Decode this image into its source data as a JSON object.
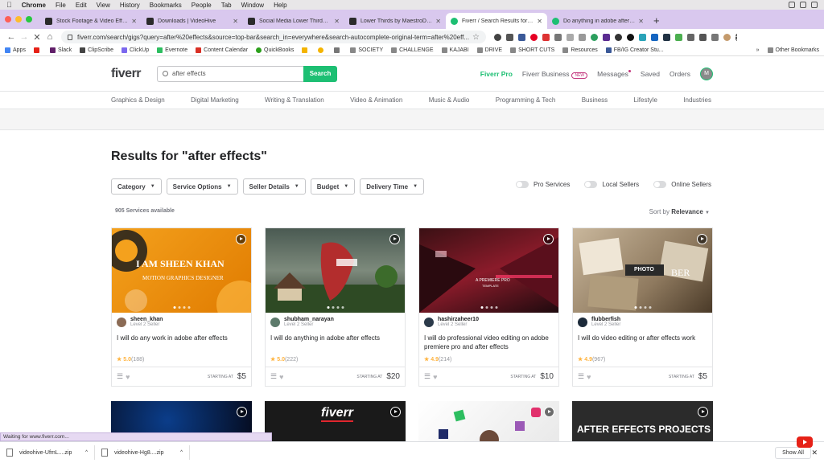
{
  "mac_menu": [
    "Chrome",
    "File",
    "Edit",
    "View",
    "History",
    "Bookmarks",
    "People",
    "Tab",
    "Window",
    "Help"
  ],
  "tabs": [
    {
      "label": "Stock Footage & Video Effects",
      "color": "#2b2b2b"
    },
    {
      "label": "Downloads | VideoHive",
      "color": "#2b2b2b"
    },
    {
      "label": "Social Media Lower Thirds V2 by",
      "color": "#2b2b2b"
    },
    {
      "label": "Lower Thirds by MaestroDesign",
      "color": "#2b2b2b"
    },
    {
      "label": "Fiverr / Search Results for 'after",
      "color": "#1dbf73"
    },
    {
      "label": "Do anything in adobe after effects",
      "color": "#1dbf73"
    }
  ],
  "address": {
    "url": "fiverr.com/search/gigs?query=after%20effects&source=top-bar&search_in=everywhere&search-autocomplete-original-term=after%20eff..."
  },
  "bookmarks": [
    "Apps",
    "",
    "Slack",
    "ClipScribe",
    "ClickUp",
    "Evernote",
    "Content Calendar",
    "QuickBooks",
    "",
    "",
    "",
    "SOCIETY",
    "CHALLENGE",
    "KAJABI",
    "DRIVE",
    "SHORT CUTS",
    "Resources",
    "FB/IG Creator Stu..."
  ],
  "other_bookmarks": "Other Bookmarks",
  "header": {
    "logo": "fiverr",
    "search_value": "after effects",
    "search_button": "Search",
    "fiverr_pro": "Fiverr Pro",
    "fiverr_business": "Fiverr Business",
    "new_badge": "NEW",
    "messages": "Messages",
    "saved": "Saved",
    "orders": "Orders",
    "avatar": "M"
  },
  "categories": [
    "Graphics & Design",
    "Digital Marketing",
    "Writing & Translation",
    "Video & Animation",
    "Music & Audio",
    "Programming & Tech",
    "Business",
    "Lifestyle",
    "Industries"
  ],
  "results_title": "Results for \"after effects\"",
  "filters": [
    "Category",
    "Service Options",
    "Seller Details",
    "Budget",
    "Delivery Time"
  ],
  "toggles": [
    "Pro Services",
    "Local Sellers",
    "Online Sellers"
  ],
  "services_count": "905 Services available",
  "sort": {
    "label": "Sort by",
    "value": "Relevance"
  },
  "gigs": [
    {
      "seller": "sheen_khan",
      "level": "Level 2 Seller",
      "title": "I will do any work in adobe after effects",
      "rating": "5.0",
      "reviews": "(188)",
      "starting": "STARTING AT",
      "price": "$5",
      "thumb_text": "I AM SHEEN KHAN",
      "thumb_sub": "MOTION GRAPHICS DESIGNER"
    },
    {
      "seller": "shubham_narayan",
      "level": "Level 2 Seller",
      "title": "I will do anything in adobe after effects",
      "rating": "5.0",
      "reviews": "(222)",
      "starting": "STARTING AT",
      "price": "$20",
      "thumb_text": "",
      "thumb_sub": ""
    },
    {
      "seller": "hashirzaheer10",
      "level": "Level 2 Seller",
      "title": "I will do professional video editing on adobe premiere pro and after effects",
      "rating": "4.9",
      "reviews": "(214)",
      "starting": "STARTING AT",
      "price": "$10",
      "thumb_text": "A PREMIERE PRO",
      "thumb_sub": "TEMPLATE"
    },
    {
      "seller": "flubberfish",
      "level": "Level 2 Seller",
      "title": "I will do video editing or after effects work",
      "rating": "4.9",
      "reviews": "(967)",
      "starting": "STARTING AT",
      "price": "$5",
      "thumb_text": "PHOTO",
      "thumb_sub": "BER"
    }
  ],
  "row2": [
    "",
    "fiverr",
    "",
    "AFTER EFFECTS PROJECTS"
  ],
  "status": "Waiting for www.fiverr.com...",
  "downloads": [
    "videohive-UfmL....zip",
    "videohive-Hg8....zip"
  ],
  "show_all": "Show All"
}
